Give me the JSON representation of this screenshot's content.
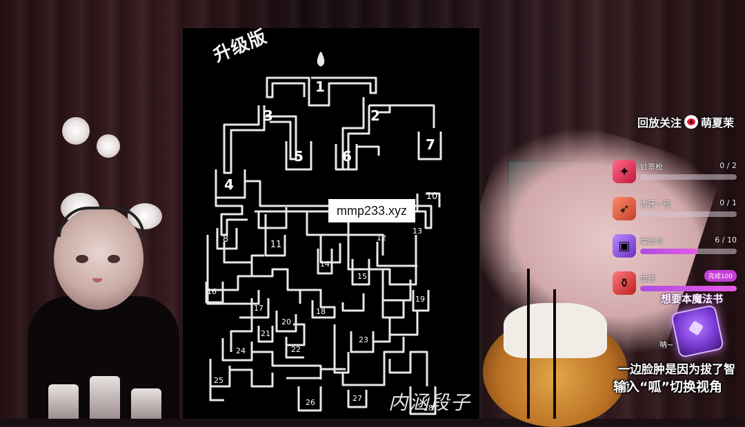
{
  "maze": {
    "title": "升级版",
    "signature": "内涵段子",
    "start_marker": "💧",
    "cells": [
      "1",
      "2",
      "3",
      "4",
      "5",
      "6",
      "7",
      "8",
      "10",
      "11",
      "12",
      "13",
      "14",
      "15",
      "16",
      "17",
      "18",
      "19",
      "20",
      "21",
      "22",
      "23",
      "24",
      "25",
      "26",
      "27",
      "28"
    ]
  },
  "watermark": "mmp233.xyz",
  "follow": {
    "prefix": "回放关注",
    "name": "萌夏茉"
  },
  "gifts": [
    {
      "name": "钞票枪",
      "count": "0 / 2",
      "progress": 0,
      "icon": "money-gun-icon",
      "color": "#e23a55"
    },
    {
      "name": "虎牙一号",
      "count": "0 / 1",
      "progress": 0,
      "icon": "rocket-icon",
      "color": "#e25a3a"
    },
    {
      "name": "魔法书",
      "count": "6 / 10",
      "progress": 0.6,
      "icon": "magic-book-icon",
      "color": "#8b3fd6"
    },
    {
      "name": "血瓶",
      "count": "完成100",
      "progress": 1.0,
      "icon": "blood-bottle-icon",
      "color": "#d83a3a",
      "done": true
    }
  ],
  "promo": {
    "title": "想要本魔法书",
    "sound": "呐~"
  },
  "subtitles": {
    "line1": "一边脸肿是因为拔了智齿",
    "line2": "输入“呱”切换视角"
  }
}
